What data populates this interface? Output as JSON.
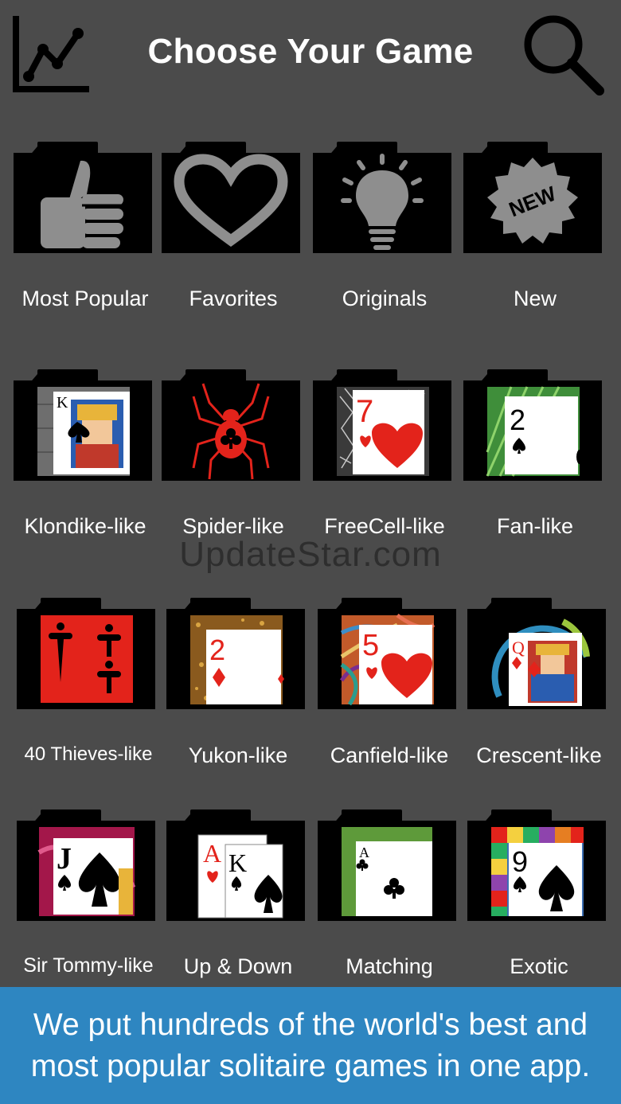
{
  "header": {
    "title": "Choose Your Game",
    "left_icon": "line-chart-icon",
    "right_icon": "search-icon"
  },
  "categories": [
    {
      "label": "Most Popular",
      "icon": "thumbs-up-icon"
    },
    {
      "label": "Favorites",
      "icon": "heart-icon"
    },
    {
      "label": "Originals",
      "icon": "lightbulb-icon"
    },
    {
      "label": "New",
      "icon": "new-badge-icon",
      "badge_text": "NEW"
    },
    {
      "label": "Klondike-like",
      "icon": "king-of-spades-card"
    },
    {
      "label": "Spider-like",
      "icon": "spider-icon"
    },
    {
      "label": "FreeCell-like",
      "icon": "seven-of-hearts-card"
    },
    {
      "label": "Fan-like",
      "icon": "two-of-spades-card"
    },
    {
      "label": "40 Thieves-like",
      "icon": "daggers-card"
    },
    {
      "label": "Yukon-like",
      "icon": "two-of-diamonds-card"
    },
    {
      "label": "Canfield-like",
      "icon": "five-of-hearts-card"
    },
    {
      "label": "Crescent-like",
      "icon": "queen-of-diamonds-card"
    },
    {
      "label": "Sir Tommy-like",
      "icon": "jack-of-spades-card"
    },
    {
      "label": "Up & Down",
      "icon": "ace-king-cards"
    },
    {
      "label": "Matching",
      "icon": "ace-of-clubs-card"
    },
    {
      "label": "Exotic",
      "icon": "nine-of-spades-card"
    }
  ],
  "card_text": {
    "k": "K",
    "seven": "7",
    "two": "2",
    "five": "5",
    "q": "Q",
    "j": "J",
    "a": "A",
    "nine": "9"
  },
  "watermark": "UpdateStar.com",
  "banner": {
    "line1": "We put hundreds of the world's best and",
    "line2": "most popular solitaire games in one app."
  },
  "colors": {
    "background": "#4b4b4b",
    "banner": "#2e86c1",
    "icon_gray": "#8e8e8e",
    "card_red": "#e3231b"
  }
}
